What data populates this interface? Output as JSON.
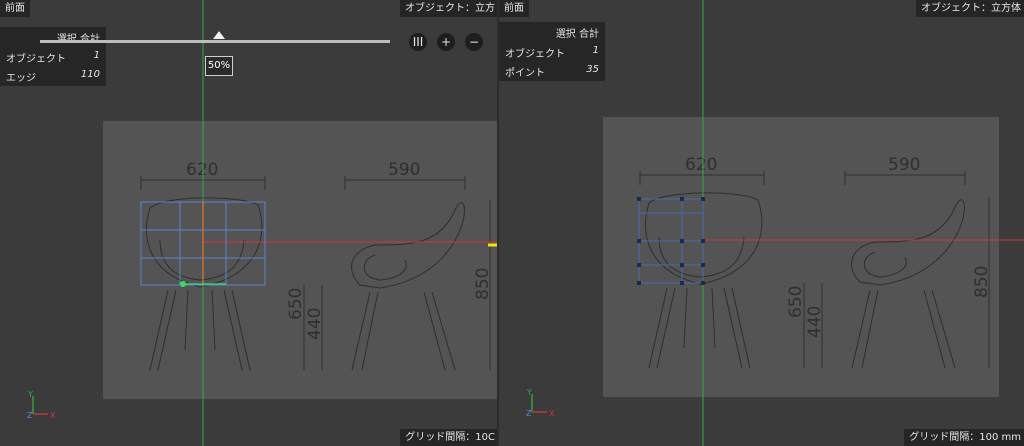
{
  "left_view": {
    "view_name": "前面",
    "object_label": "オブジェクト：立方",
    "grid_label": "グリッド間隔：10C",
    "stats": {
      "header": "選択 合計",
      "rows": [
        {
          "label": "オブジェクト",
          "value": "1"
        },
        {
          "label": "エッジ",
          "value": "110"
        }
      ]
    },
    "slider": {
      "value_text": "50%",
      "level": 0.5
    },
    "buttons": {
      "grid": "III",
      "plus": "+",
      "minus": "−"
    },
    "drawing": {
      "width_left": "620",
      "width_right": "590",
      "height_seat": "650",
      "height_inner": "440",
      "height_total": "850"
    },
    "axis": {
      "y": "Y",
      "x": "X",
      "z": "Z"
    }
  },
  "right_view": {
    "view_name": "前面",
    "object_label": "オブジェクト：立方体",
    "grid_label": "グリッド間隔：100 mm",
    "stats": {
      "header": "選択 合計",
      "rows": [
        {
          "label": "オブジェクト",
          "value": "1"
        },
        {
          "label": "ポイント",
          "value": "35"
        }
      ]
    },
    "drawing": {
      "width_left": "620",
      "width_right": "590",
      "height_seat": "650",
      "height_inner": "440",
      "height_total": "850"
    },
    "axis": {
      "y": "Y",
      "x": "X",
      "z": "Z"
    }
  },
  "colors": {
    "arrow": "#f2e600",
    "axis_y": "#37a84a",
    "axis_x": "#c8393b",
    "cage": "#5b86c9",
    "point": "#3ddc6a",
    "edge": "#e07a2a"
  }
}
